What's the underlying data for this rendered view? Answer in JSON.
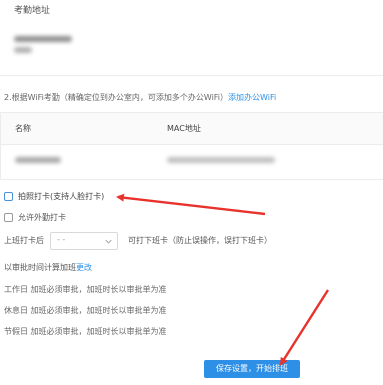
{
  "address_section": {
    "title": "考勤地址"
  },
  "wifi_section": {
    "intro_text": "2.根据WiFi考勤（精确定位到办公室内，可添加多个办公WiFi）",
    "add_link": "添加办公WiFi",
    "columns": [
      "名称",
      "MAC地址"
    ]
  },
  "options": {
    "photo_punch_label": "拍照打卡(支持人脸打卡)",
    "photo_punch_checked": false,
    "outside_punch_label": "允许外勤打卡",
    "outside_punch_checked": false,
    "punch_time_label": "上班打卡后",
    "punch_time_value": "- -",
    "punch_time_suffix": "可打下班卡（防止误操作，误打下班卡）"
  },
  "overtime": {
    "rule_text": "以审批时间计算加班",
    "change_link": "更改",
    "workday": "工作日  加班必须审批，加班时长以审批单为准",
    "restday": "休息日  加班必须审批，加班时长以审批单为准",
    "holiday": "节假日  加班必须审批，加班时长以审批单为准"
  },
  "actions": {
    "save_label": "保存设置，开始排班"
  },
  "colors": {
    "accent": "#2d8fe6",
    "annotation": "#e8322b"
  },
  "icons": {
    "select_chevron": "chevron-down-icon"
  }
}
